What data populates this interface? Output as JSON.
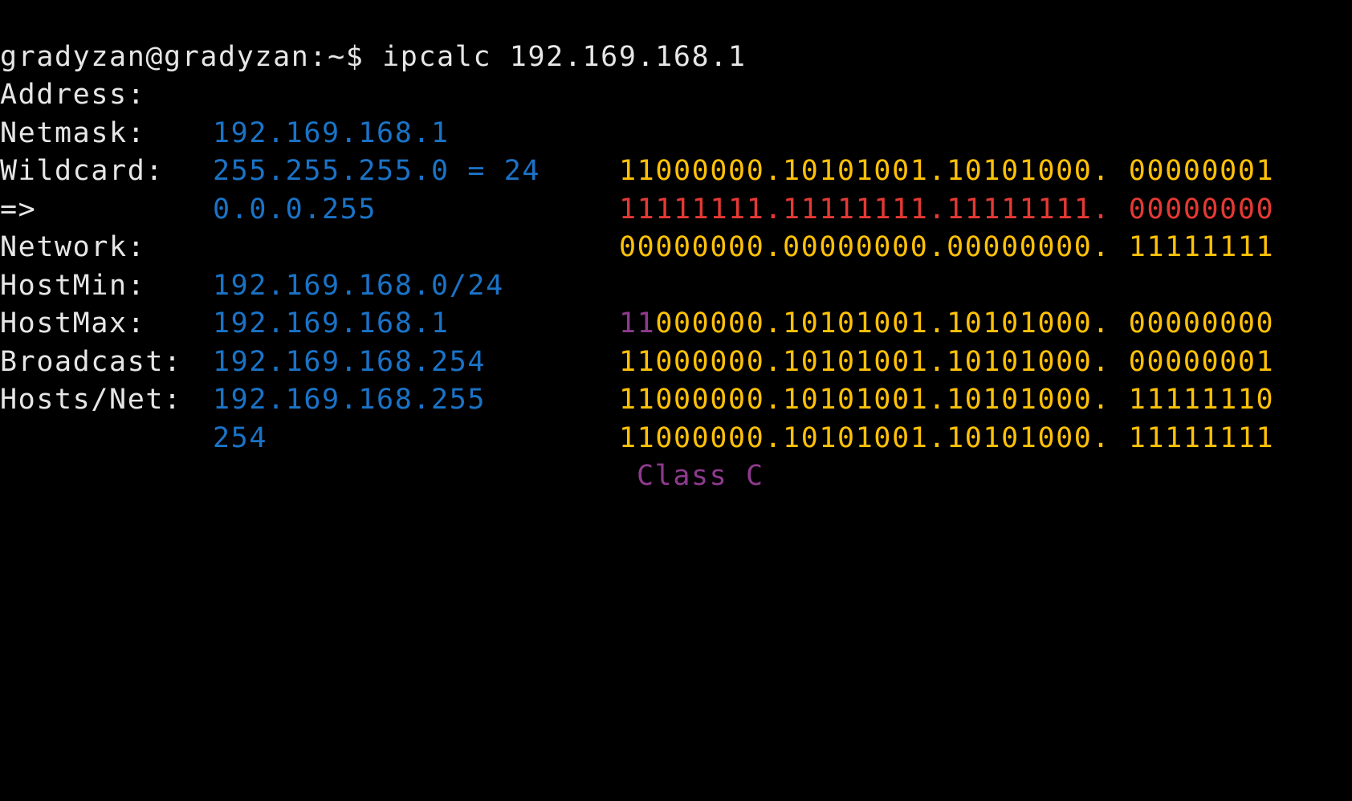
{
  "colors": {
    "background": "#000000",
    "text": "#e6e6e6",
    "value": "#1a73c7",
    "binary": "#ffc107",
    "netmask_binary": "#e53935",
    "class_marker": "#8e3a8e"
  },
  "terminal": {
    "prompt": "gradyzan@gradyzan:~$ ",
    "command": "ipcalc 192.169.168.1",
    "arrow": "=>",
    "rows": [
      {
        "label": "Address:",
        "value": "192.169.168.1",
        "bin_a": "11000000.10101001.10101000.",
        "bin_b": " 00000001"
      },
      {
        "label": "Netmask:",
        "value": "255.255.255.0 = 24",
        "bin_a": "11111111.11111111.11111111.",
        "bin_b": " 00000000"
      },
      {
        "label": "Wildcard:",
        "value": "0.0.0.255",
        "bin_a": "00000000.00000000.00000000.",
        "bin_b": " 11111111"
      },
      {
        "label": "Network:",
        "value": "192.169.168.0/24",
        "bin_class": "11",
        "bin_a": "000000.10101001.10101000.",
        "bin_b": " 00000000"
      },
      {
        "label": "HostMin:",
        "value": "192.169.168.1",
        "bin_a": "11000000.10101001.10101000.",
        "bin_b": " 00000001"
      },
      {
        "label": "HostMax:",
        "value": "192.169.168.254",
        "bin_a": "11000000.10101001.10101000.",
        "bin_b": " 11111110"
      },
      {
        "label": "Broadcast:",
        "value": "192.169.168.255",
        "bin_a": "11000000.10101001.10101000.",
        "bin_b": " 11111111"
      },
      {
        "label": "Hosts/Net:",
        "value": "254",
        "class_text": "Class C"
      }
    ]
  }
}
